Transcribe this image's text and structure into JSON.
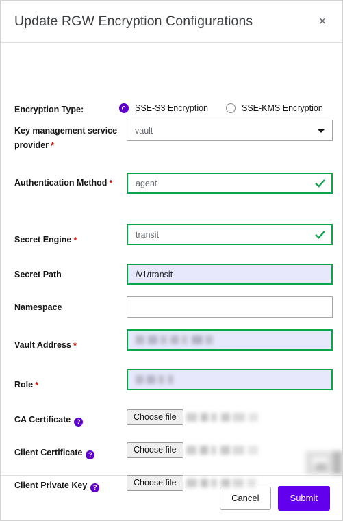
{
  "dialog": {
    "title": "Update RGW Encryption Configurations",
    "close_icon": "close-icon"
  },
  "form": {
    "encryption_type": {
      "label": "Encryption Type:",
      "options": [
        {
          "label": "SSE-S3 Encryption",
          "selected": true
        },
        {
          "label": "SSE-KMS Encryption",
          "selected": false
        }
      ]
    },
    "fields": [
      {
        "key": "kms_provider",
        "label": "Key management service provider",
        "required": true,
        "type": "select",
        "value": "vault"
      },
      {
        "key": "auth_method",
        "label": "Authentication Method",
        "required": true,
        "type": "text",
        "value": "agent",
        "state": "valid"
      },
      {
        "key": "secret_engine",
        "label": "Secret Engine",
        "required": true,
        "type": "text",
        "value": "transit",
        "state": "valid"
      },
      {
        "key": "secret_path",
        "label": "Secret Path",
        "required": false,
        "type": "text",
        "value": "/v1/transit",
        "state": "valid-autofill"
      },
      {
        "key": "namespace",
        "label": "Namespace",
        "required": false,
        "type": "text",
        "value": "",
        "state": "default"
      },
      {
        "key": "vault_address",
        "label": "Vault Address",
        "required": true,
        "type": "text",
        "value": "",
        "redacted": true,
        "redacted_width": 120,
        "state": "valid-autofill"
      },
      {
        "key": "role",
        "label": "Role",
        "required": true,
        "type": "text",
        "value": "",
        "redacted": true,
        "redacted_width": 52,
        "state": "valid-autofill"
      }
    ],
    "file_fields": [
      {
        "key": "ca_certificate",
        "label": "CA Certificate",
        "help_icon": "help-icon",
        "button_label": "Choose file",
        "file_name": "",
        "redacted": true
      },
      {
        "key": "client_certificate",
        "label": "Client Certificate",
        "help_icon": "help-icon",
        "button_label": "Choose file",
        "file_name": "",
        "redacted": true
      },
      {
        "key": "client_private_key",
        "label": "Client Private Key",
        "help_icon": "help-icon",
        "button_label": "Choose file",
        "file_name": "",
        "redacted": true
      }
    ]
  },
  "footer": {
    "cancel_label": "Cancel",
    "submit_label": "Submit"
  },
  "colors": {
    "accent_purple": "#6200ee",
    "radio_purple": "#5e00c8",
    "valid_green": "#0ba54a",
    "required_red": "#c9190b",
    "autofill_bg": "#e8e8fd"
  }
}
